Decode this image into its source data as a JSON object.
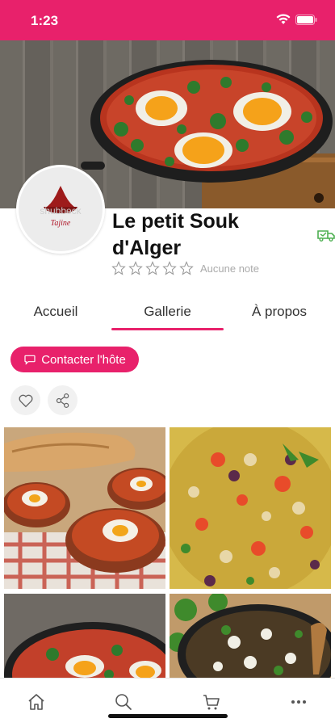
{
  "status_bar": {
    "time": "1:23"
  },
  "shop": {
    "logo_text": "shubbeck",
    "logo_sub": "Tajine",
    "title": "Le petit Souk d'Alger",
    "rating_text": "Aucune note",
    "stars": 0
  },
  "tabs": [
    {
      "label": "Accueil"
    },
    {
      "label": "Gallerie",
      "active": true
    },
    {
      "label": "À propos"
    }
  ],
  "actions": {
    "contact_label": "Contacter l'hôte"
  },
  "gallery": [
    {
      "alt": "Shakshuka in clay bowls with bread"
    },
    {
      "alt": "Couscous with vegetables and chickpeas"
    },
    {
      "alt": "Shakshuka in pan"
    },
    {
      "alt": "Vegetable skillet with feta"
    }
  ],
  "bottom_nav": [
    "home",
    "search",
    "cart",
    "more"
  ],
  "colors": {
    "accent": "#e8216b"
  }
}
